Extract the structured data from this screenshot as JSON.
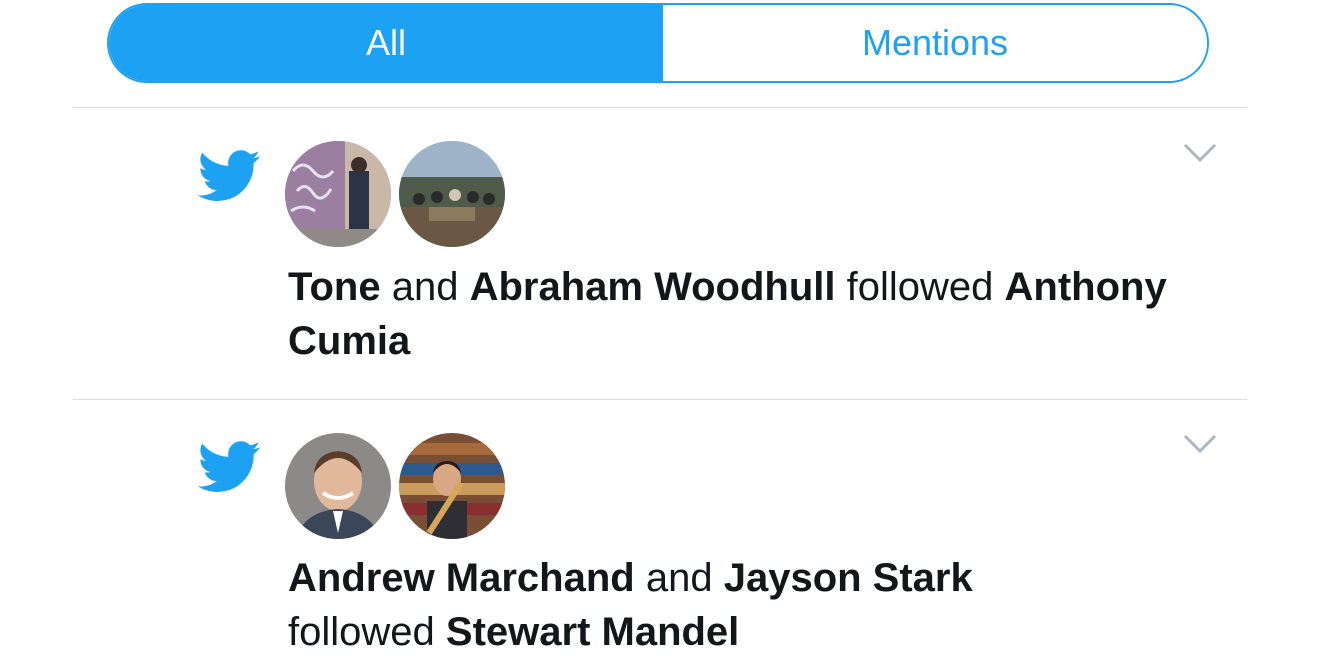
{
  "tabs": {
    "all_label": "All",
    "mentions_label": "Mentions",
    "selected": "All"
  },
  "colors": {
    "accent": "#1da1f2",
    "text": "#14171a",
    "divider": "#d9dde1"
  },
  "notifications": [
    {
      "icon": "twitter-bird-icon",
      "actor1": "Tone",
      "conj": "and",
      "actor2": "Abraham Woodhull",
      "verb": "followed",
      "target": "Anthony Cumia"
    },
    {
      "icon": "twitter-bird-icon",
      "actor1": "Andrew Marchand",
      "conj": "and",
      "actor2": "Jayson Stark",
      "verb": "followed",
      "target": "Stewart Mandel"
    }
  ]
}
